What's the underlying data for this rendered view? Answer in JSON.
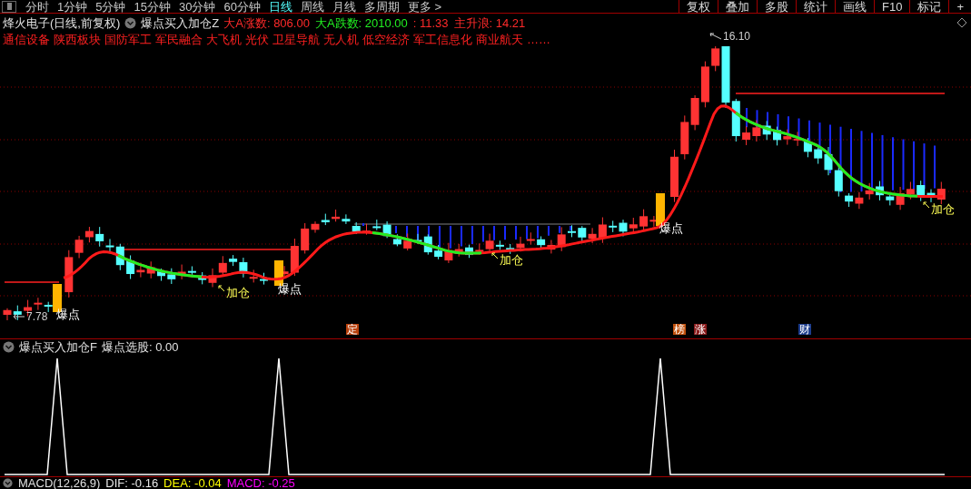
{
  "toolbar": {
    "periods": [
      {
        "label": "分时",
        "selected": false
      },
      {
        "label": "1分钟",
        "selected": false
      },
      {
        "label": "5分钟",
        "selected": false
      },
      {
        "label": "15分钟",
        "selected": false
      },
      {
        "label": "30分钟",
        "selected": false
      },
      {
        "label": "60分钟",
        "selected": false
      },
      {
        "label": "日线",
        "selected": true
      },
      {
        "label": "周线",
        "selected": false
      },
      {
        "label": "月线",
        "selected": false
      },
      {
        "label": "多周期",
        "selected": false
      },
      {
        "label": "更多 >",
        "selected": false
      }
    ],
    "tools": [
      "复权",
      "叠加",
      "多股",
      "统计",
      "画线",
      "F10",
      "标记",
      "+"
    ]
  },
  "header": {
    "stock": "烽火电子(日线,前复权)",
    "indicator": "爆点买入加仓Z",
    "stats": [
      {
        "text": "大A涨数: 806.00",
        "color": "#ff2a2a"
      },
      {
        "text": "大A跌数: 2010.00",
        "color": "#22ee22"
      },
      {
        "text": ": 11.33",
        "color": "#ff2a2a"
      },
      {
        "text": "主升浪: 14.21",
        "color": "#ff2a2a"
      }
    ]
  },
  "concepts": [
    "通信设备",
    "陕西板块",
    "国防军工",
    "军民融合",
    "大飞机",
    "光伏",
    "卫星导航",
    "无人机",
    "低空经济",
    "军工信息化",
    "商业航天",
    "……"
  ],
  "price_chart": {
    "high_label": "16.10",
    "low_label": "7.78",
    "signals": [
      {
        "kind": "burst",
        "text": "爆点"
      },
      {
        "kind": "add",
        "text": "加仓"
      },
      {
        "kind": "burst",
        "text": "爆点"
      },
      {
        "kind": "add",
        "text": "加仓"
      },
      {
        "kind": "burst",
        "text": "爆点"
      },
      {
        "kind": "add",
        "text": "加仓"
      }
    ],
    "event_tags": [
      {
        "text": "定",
        "color": "#b8400c"
      },
      {
        "text": "榜",
        "color": "#c0500c"
      },
      {
        "text": "涨",
        "color": "#8a1c1c"
      },
      {
        "text": "财",
        "color": "#1c3c8c"
      }
    ]
  },
  "sub_panel": {
    "indicator": "爆点买入加仓F",
    "reading": "爆点选股: 0.00"
  },
  "macd": {
    "name": "MACD(12,26,9)",
    "values": [
      {
        "text": "DIF: -0.16",
        "color": "#e8e8e8"
      },
      {
        "text": "DEA: -0.04",
        "color": "#ffff00"
      },
      {
        "text": "MACD: -0.25",
        "color": "#ff00ff"
      }
    ]
  }
}
